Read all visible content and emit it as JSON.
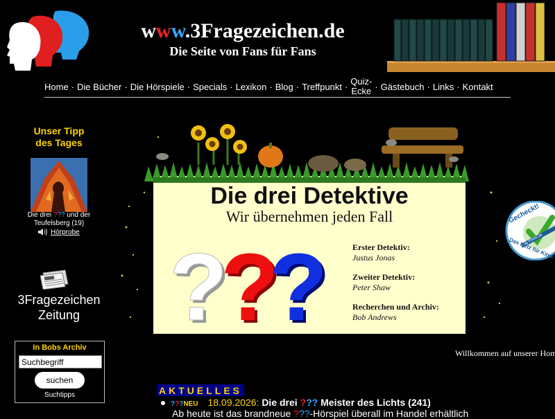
{
  "header": {
    "title_w1": "w",
    "title_w2": "w",
    "title_w3": "w",
    "title_rest": ".3Fragezeichen.de",
    "subtitle": "Die Seite von Fans für Fans"
  },
  "nav": {
    "items": [
      "Home",
      "Die Bücher",
      "Die Hörspiele",
      "Specials",
      "Lexikon",
      "Blog",
      "Treffpunkt",
      "Quiz-",
      "Ecke",
      "Gästebuch",
      "Links",
      "Kontakt"
    ],
    "separator": "·"
  },
  "sidebar": {
    "tipp_title_1": "Unser Tipp",
    "tipp_title_2": "des Tages",
    "tipp_caption_pre": "Die drei ",
    "tipp_caption_q1": "?",
    "tipp_caption_q2": "??",
    "tipp_caption_post": " und der",
    "tipp_caption_line2": "Teufelsberg (19)",
    "tipp_link": "Hörprobe",
    "zeitung_1": "3Fragezeichen",
    "zeitung_2": "Zeitung",
    "archiv_title": "In Bobs Archiv",
    "search_value": "Suchbegriff",
    "search_button": "suchen",
    "search_tips": "Suchtipps"
  },
  "banner": {
    "title": "Die drei Detektive",
    "subtitle": "Wir übernehmen jeden Fall",
    "roles": [
      {
        "role": "Erster Detektiv:",
        "name": "Justus Jonas"
      },
      {
        "role": "Zweiter Detektiv:",
        "name": "Peter Shaw"
      },
      {
        "role": "Recherchen und Archiv:",
        "name": "Bob Andrews"
      }
    ]
  },
  "seal": {
    "line1": "Gecheckt!",
    "line2": "frag FINN.de",
    "line3": "Das Netz für Kinder"
  },
  "welcome": "Willkommen auf unserer Homepage",
  "aktuelles": {
    "heading": "AKTUELLES",
    "items": [
      {
        "neu_q1": "?",
        "neu_q2": "?",
        "neu_q3": "?",
        "neu_text": "NEU",
        "date": "18.09.2026:",
        "title_pre": "Die drei ",
        "title_q1": "?",
        "title_q2": "??",
        "title_post": " Meister des Lichts (241)",
        "sub_pre": "Ab heute ist das brandneue ",
        "sub_q1": "?",
        "sub_q2": "??",
        "sub_post": "-Hörspiel überall im Handel erhältlich"
      }
    ]
  },
  "colors": {
    "background": "#000000",
    "accent_yellow": "#ffd400",
    "red": "#e22222",
    "blue": "#33aaff",
    "aktuelles_bg": "#00008b",
    "banner_paper": "#ffffcc"
  }
}
